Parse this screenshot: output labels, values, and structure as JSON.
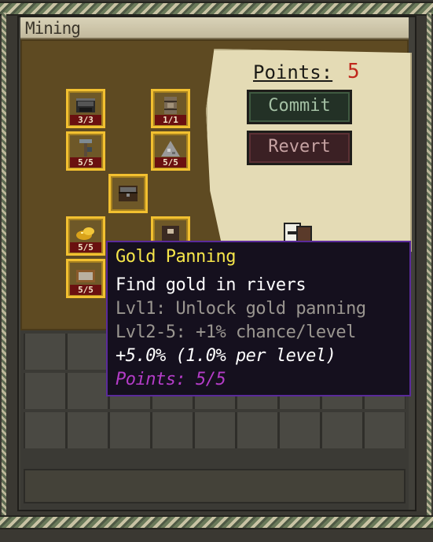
{
  "window": {
    "title": "Mining"
  },
  "points": {
    "label": "Points:",
    "value": "5"
  },
  "buttons": {
    "commit": "Commit",
    "revert": "Revert"
  },
  "skills": [
    {
      "name": "skill-furnace",
      "count": "3/3"
    },
    {
      "name": "skill-barrel",
      "count": "1/1"
    },
    {
      "name": "skill-pickaxe",
      "count": "5/5"
    },
    {
      "name": "skill-ore",
      "count": "5/5"
    },
    {
      "name": "skill-chest",
      "count": ""
    },
    {
      "name": "skill-gold-nugget",
      "count": "5/5"
    },
    {
      "name": "skill-gold-panning",
      "count": "5/5"
    },
    {
      "name": "skill-dark-chest",
      "count": ""
    }
  ],
  "tooltip": {
    "title": "Gold Panning",
    "description": "Find gold in rivers",
    "level1": "Lvl1: Unlock gold panning",
    "level2": "Lvl2-5: +1% chance/level",
    "bonus": "+5.0% (1.0% per level)",
    "points": "Points: 5/5"
  },
  "colors": {
    "slot_border": "#f2c030",
    "tooltip_title": "#f6e64a",
    "tooltip_points": "#b43cc8",
    "points_value": "#c0281d"
  }
}
